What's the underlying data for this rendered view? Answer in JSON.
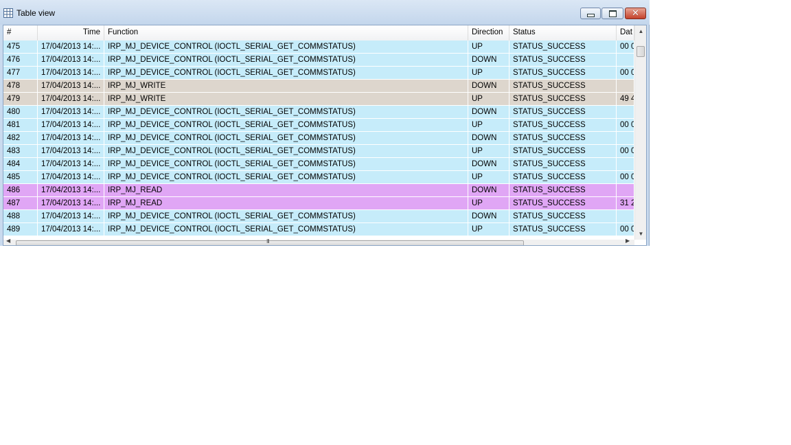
{
  "window": {
    "title": "Table view",
    "icon": "table-icon",
    "close_glyph": "✕"
  },
  "columns": [
    "#",
    "Time",
    "Function",
    "Direction",
    "Status",
    "Dat"
  ],
  "colors": {
    "serial": "#c6ecfa",
    "write": "#ddd6cd",
    "read": "#e0a6f5"
  },
  "rows": [
    {
      "num": "475",
      "time": "17/04/2013 14:...",
      "function": "IRP_MJ_DEVICE_CONTROL (IOCTL_SERIAL_GET_COMMSTATUS)",
      "direction": "UP",
      "status": "STATUS_SUCCESS",
      "data": "00 0",
      "kind": "serial"
    },
    {
      "num": "476",
      "time": "17/04/2013 14:...",
      "function": "IRP_MJ_DEVICE_CONTROL (IOCTL_SERIAL_GET_COMMSTATUS)",
      "direction": "DOWN",
      "status": "STATUS_SUCCESS",
      "data": "",
      "kind": "serial"
    },
    {
      "num": "477",
      "time": "17/04/2013 14:...",
      "function": "IRP_MJ_DEVICE_CONTROL (IOCTL_SERIAL_GET_COMMSTATUS)",
      "direction": "UP",
      "status": "STATUS_SUCCESS",
      "data": "00 0",
      "kind": "serial"
    },
    {
      "num": "478",
      "time": "17/04/2013 14:...",
      "function": "IRP_MJ_WRITE",
      "direction": "DOWN",
      "status": "STATUS_SUCCESS",
      "data": "",
      "kind": "write"
    },
    {
      "num": "479",
      "time": "17/04/2013 14:...",
      "function": "IRP_MJ_WRITE",
      "direction": "UP",
      "status": "STATUS_SUCCESS",
      "data": "49 4",
      "kind": "write"
    },
    {
      "num": "480",
      "time": "17/04/2013 14:...",
      "function": "IRP_MJ_DEVICE_CONTROL (IOCTL_SERIAL_GET_COMMSTATUS)",
      "direction": "DOWN",
      "status": "STATUS_SUCCESS",
      "data": "",
      "kind": "serial"
    },
    {
      "num": "481",
      "time": "17/04/2013 14:...",
      "function": "IRP_MJ_DEVICE_CONTROL (IOCTL_SERIAL_GET_COMMSTATUS)",
      "direction": "UP",
      "status": "STATUS_SUCCESS",
      "data": "00 0",
      "kind": "serial"
    },
    {
      "num": "482",
      "time": "17/04/2013 14:...",
      "function": "IRP_MJ_DEVICE_CONTROL (IOCTL_SERIAL_GET_COMMSTATUS)",
      "direction": "DOWN",
      "status": "STATUS_SUCCESS",
      "data": "",
      "kind": "serial"
    },
    {
      "num": "483",
      "time": "17/04/2013 14:...",
      "function": "IRP_MJ_DEVICE_CONTROL (IOCTL_SERIAL_GET_COMMSTATUS)",
      "direction": "UP",
      "status": "STATUS_SUCCESS",
      "data": "00 0",
      "kind": "serial"
    },
    {
      "num": "484",
      "time": "17/04/2013 14:...",
      "function": "IRP_MJ_DEVICE_CONTROL (IOCTL_SERIAL_GET_COMMSTATUS)",
      "direction": "DOWN",
      "status": "STATUS_SUCCESS",
      "data": "",
      "kind": "serial"
    },
    {
      "num": "485",
      "time": "17/04/2013 14:...",
      "function": "IRP_MJ_DEVICE_CONTROL (IOCTL_SERIAL_GET_COMMSTATUS)",
      "direction": "UP",
      "status": "STATUS_SUCCESS",
      "data": "00 0",
      "kind": "serial"
    },
    {
      "num": "486",
      "time": "17/04/2013 14:...",
      "function": "IRP_MJ_READ",
      "direction": "DOWN",
      "status": "STATUS_SUCCESS",
      "data": "",
      "kind": "read"
    },
    {
      "num": "487",
      "time": "17/04/2013 14:...",
      "function": "IRP_MJ_READ",
      "direction": "UP",
      "status": "STATUS_SUCCESS",
      "data": "31 2",
      "kind": "read"
    },
    {
      "num": "488",
      "time": "17/04/2013 14:...",
      "function": "IRP_MJ_DEVICE_CONTROL (IOCTL_SERIAL_GET_COMMSTATUS)",
      "direction": "DOWN",
      "status": "STATUS_SUCCESS",
      "data": "",
      "kind": "serial"
    },
    {
      "num": "489",
      "time": "17/04/2013 14:...",
      "function": "IRP_MJ_DEVICE_CONTROL (IOCTL_SERIAL_GET_COMMSTATUS)",
      "direction": "UP",
      "status": "STATUS_SUCCESS",
      "data": "00 0",
      "kind": "serial"
    }
  ],
  "scrollbars": {
    "up_arrow": "▲",
    "down_arrow": "▼",
    "left_arrow": "◀",
    "right_arrow": "▶",
    "grip": "III"
  }
}
